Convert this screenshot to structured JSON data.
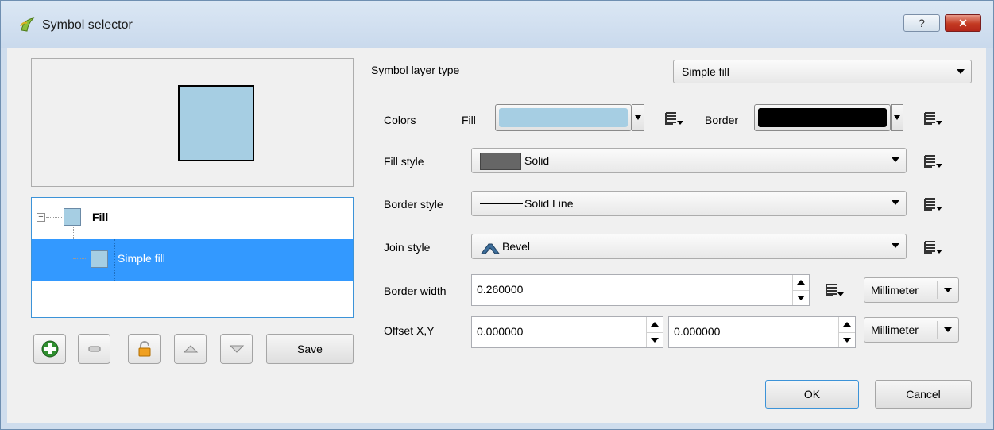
{
  "window": {
    "title": "Symbol selector",
    "help_label": "?",
    "close_label": "✕"
  },
  "tree": {
    "items": [
      {
        "label": "Fill",
        "selected": false
      },
      {
        "label": "Simple fill",
        "selected": true
      }
    ]
  },
  "left_buttons": {
    "save_label": "Save"
  },
  "form": {
    "symbol_layer_type": {
      "label": "Symbol layer type",
      "value": "Simple fill"
    },
    "colors": {
      "label": "Colors",
      "fill_label": "Fill",
      "fill_color": "#a6cee3",
      "border_label": "Border",
      "border_color": "#000000"
    },
    "fill_style": {
      "label": "Fill style",
      "value": "Solid"
    },
    "border_style": {
      "label": "Border style",
      "value": "Solid Line"
    },
    "join_style": {
      "label": "Join style",
      "value": "Bevel"
    },
    "border_width": {
      "label": "Border width",
      "value": "0.260000",
      "unit": "Millimeter"
    },
    "offset": {
      "label": "Offset X,Y",
      "x": "0.000000",
      "y": "0.000000",
      "unit": "Millimeter"
    }
  },
  "dialog_buttons": {
    "ok": "OK",
    "cancel": "Cancel"
  },
  "icons": {
    "app": "qgis-icon",
    "data_defined": "data-defined-override-icon",
    "add": "add-layer-icon",
    "remove": "remove-layer-icon",
    "lock": "lock-icon",
    "up": "move-up-icon",
    "down": "move-down-icon"
  }
}
